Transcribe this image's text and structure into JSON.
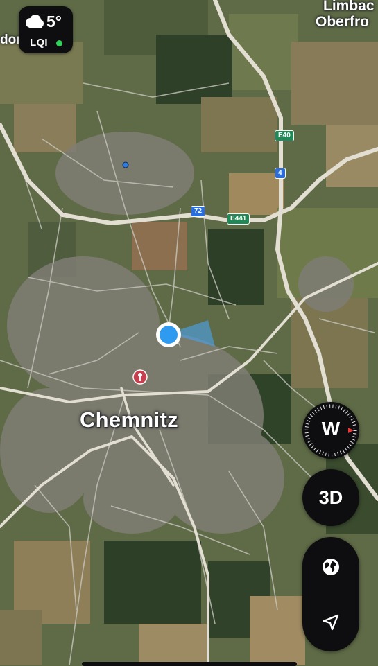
{
  "map": {
    "city_label": "Chemnitz",
    "edge_label_left": "dor",
    "edge_label_top_line1": "Limbac",
    "edge_label_top_line2": "Oberfro",
    "road_signs": [
      "E40",
      "4",
      "72",
      "E441"
    ]
  },
  "weather": {
    "temperature": "5°",
    "aqi_label": "LQI",
    "icon": "cloud-icon",
    "aqi_status_color": "#2fd35a"
  },
  "controls": {
    "compass_heading": "W",
    "view_3d_label": "3D",
    "map_mode_icon": "globe-icon",
    "locate_icon": "location-arrow-icon"
  },
  "colors": {
    "user_location": "#2e9bf0",
    "marker_pin": "#c8404e"
  }
}
